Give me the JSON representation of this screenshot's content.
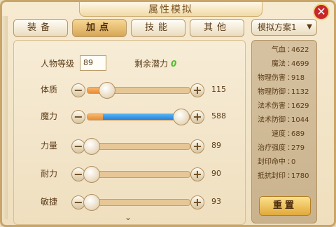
{
  "window": {
    "title": "属性模拟",
    "close_label": "✕"
  },
  "tabs": [
    {
      "label": "装备",
      "active": false
    },
    {
      "label": "加点",
      "active": true
    },
    {
      "label": "技能",
      "active": false
    },
    {
      "label": "其他",
      "active": false
    }
  ],
  "level": {
    "label": "人物等级",
    "value": "89"
  },
  "potential": {
    "label": "剩余潜力",
    "value": "0"
  },
  "attributes": [
    {
      "label": "体质",
      "value": "115",
      "base_fraction": 0.15,
      "added_fraction": 0.0
    },
    {
      "label": "魔力",
      "value": "588",
      "base_fraction": 0.15,
      "added_fraction": 0.73
    },
    {
      "label": "力量",
      "value": "89",
      "base_fraction": 0.0,
      "added_fraction": 0.0
    },
    {
      "label": "耐力",
      "value": "90",
      "base_fraction": 0.0,
      "added_fraction": 0.0
    },
    {
      "label": "敏捷",
      "value": "93",
      "base_fraction": 0.0,
      "added_fraction": 0.0
    }
  ],
  "stepper": {
    "minus": "−",
    "plus": "+"
  },
  "more_indicator": "⌄",
  "plan": {
    "label": "模拟方案1",
    "caret": "▼"
  },
  "stats": [
    {
      "name": "气血",
      "value": "4622"
    },
    {
      "name": "魔法",
      "value": "4699"
    },
    {
      "name": "物理伤害",
      "value": "918"
    },
    {
      "name": "物理防御",
      "value": "1132"
    },
    {
      "name": "法术伤害",
      "value": "1629"
    },
    {
      "name": "法术防御",
      "value": "1044"
    },
    {
      "name": "速度",
      "value": "689"
    },
    {
      "name": "治疗强度",
      "value": "279"
    },
    {
      "name": "封印命中",
      "value": "0"
    },
    {
      "name": "抵抗封印",
      "value": "1780"
    }
  ],
  "stat_separator": "：",
  "reset_label": "重置",
  "colors": {
    "accent_orange": "#e88c3a",
    "added_blue": "#2c7fd6",
    "potential_green": "#4bbf2a",
    "close_red": "#c8262a"
  }
}
